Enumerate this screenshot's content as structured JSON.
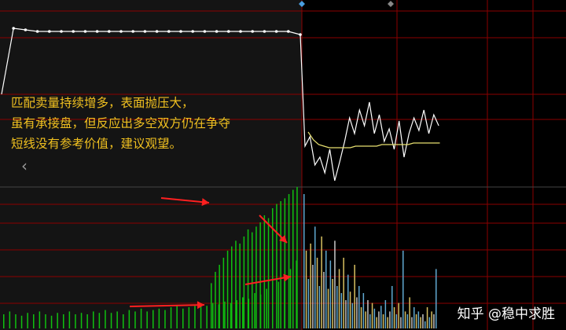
{
  "annotation": {
    "lines": [
      "匹配卖量持续增多，表面抛压大，",
      "虽有承接盘，但反应出多空双方仍在争夺",
      "短线没有参考价值，建议观望。"
    ]
  },
  "nav": {
    "back_icon": "chevron-left-icon",
    "back_glyph": "‹"
  },
  "watermark": {
    "text": "知乎 @稳中求胜"
  },
  "colors": {
    "background": "#000000",
    "grid": "#8b0000",
    "annotation": "#f0c020",
    "price_line": "#ffffff",
    "avg_line": "#e8e070",
    "volume_green": "#10c010",
    "volume_yellow": "#d8c060",
    "volume_cyan": "#60a8d0",
    "arrow": "#ff2020",
    "marker_blue": "#4a9ee0"
  },
  "chart_data": {
    "type": "line",
    "series": [
      {
        "values": [
          0.55,
          0.97,
          0.96,
          0.95,
          0.95,
          0.95,
          0.95,
          0.95,
          0.95,
          0.95,
          0.95,
          0.95,
          0.95,
          0.95,
          0.95,
          0.95,
          0.95,
          0.95,
          0.95,
          0.95,
          0.95,
          0.95,
          0.95,
          0.95,
          0.95,
          0.93,
          0.22,
          0.28,
          0.1,
          0.15,
          0.05,
          0.2,
          0.0,
          0.12,
          0.25,
          0.4,
          0.3,
          0.45,
          0.35,
          0.5,
          0.3,
          0.42,
          0.25,
          0.33,
          0.2,
          0.38,
          0.15,
          0.3,
          0.4,
          0.32,
          0.45,
          0.3,
          0.42,
          0.35
        ]
      },
      {
        "values": [
          0.31,
          0.26,
          0.23,
          0.22,
          0.21,
          0.21,
          0.21,
          0.21,
          0.21,
          0.22,
          0.22,
          0.22,
          0.22,
          0.22,
          0.23,
          0.23,
          0.23,
          0.23,
          0.23,
          0.23,
          0.24,
          0.24,
          0.24,
          0.24,
          0.24,
          0.24
        ]
      }
    ],
    "volume": {
      "green_pre": [
        0.1,
        0.12,
        0.1,
        0.09,
        0.11,
        0.1,
        0.12,
        0.1,
        0.09,
        0.11,
        0.1,
        0.12,
        0.1,
        0.11,
        0.1,
        0.12,
        0.11,
        0.13,
        0.11,
        0.12,
        0.1,
        0.13,
        0.12,
        0.14,
        0.12,
        0.13,
        0.14,
        0.13,
        0.15,
        0.16,
        0.14,
        0.15,
        0.16,
        0.17,
        0.16,
        0.18,
        0.17,
        0.19,
        0.18,
        0.2,
        0.22,
        0.21,
        0.25,
        0.24,
        0.28,
        0.3,
        0.33,
        0.37,
        0.42,
        0.48
      ],
      "green_late": [
        0.32,
        0.4,
        0.45,
        0.5,
        0.55,
        0.58,
        0.62,
        0.6,
        0.65,
        0.7,
        0.68,
        0.72,
        0.75,
        0.8,
        0.78,
        0.85,
        0.88,
        0.9,
        0.92,
        0.95,
        0.98,
        1.0
      ],
      "colored_bars": [
        0.95,
        0.55,
        0.35,
        0.6,
        0.45,
        0.72,
        0.5,
        0.3,
        0.65,
        0.4,
        0.55,
        0.28,
        0.48,
        0.35,
        0.62,
        0.3,
        0.42,
        0.25,
        0.5,
        0.2,
        0.38,
        0.26,
        0.18,
        0.45,
        0.22,
        0.3,
        0.15,
        0.25,
        0.12,
        0.2,
        0.1,
        0.18,
        0.14,
        0.08,
        0.12,
        0.16,
        0.1,
        0.2,
        0.08,
        0.12,
        0.3,
        0.15,
        0.1,
        0.18,
        0.08,
        0.55,
        0.12,
        0.1,
        0.22,
        0.08,
        0.15,
        0.1,
        0.12,
        0.08,
        0.1,
        0.05,
        0.15,
        0.08,
        0.12,
        0.1,
        0.42
      ]
    }
  }
}
